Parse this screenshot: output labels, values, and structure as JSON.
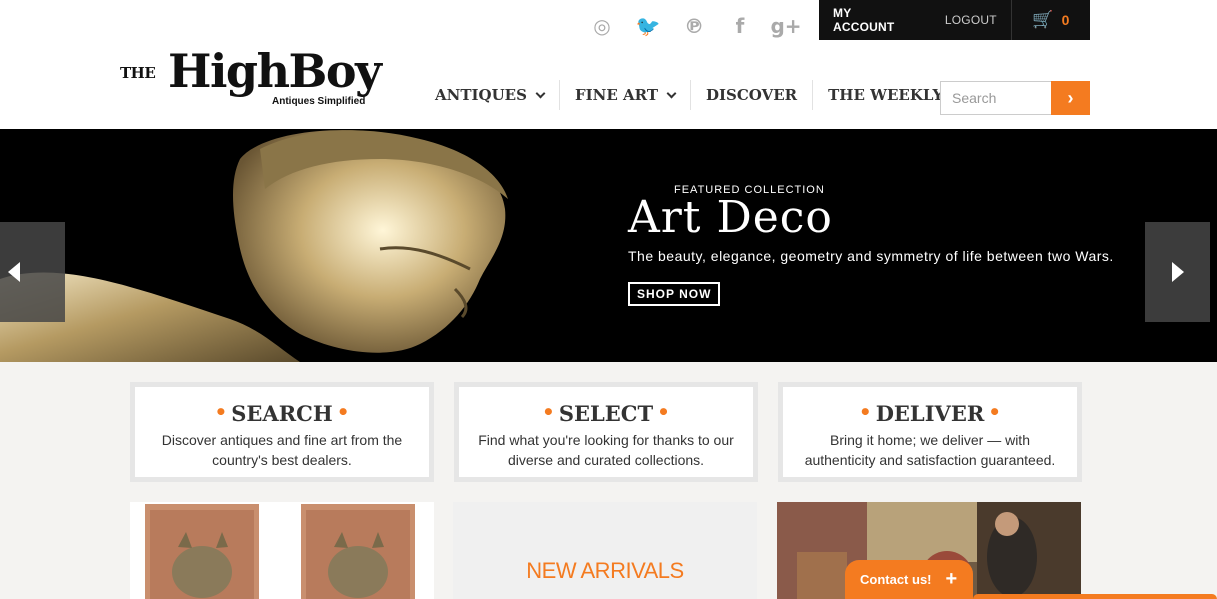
{
  "header": {
    "social": [
      {
        "name": "instagram-icon",
        "glyph": "◎"
      },
      {
        "name": "twitter-icon",
        "glyph": "🐦"
      },
      {
        "name": "pinterest-icon",
        "glyph": "℗"
      },
      {
        "name": "facebook-icon",
        "glyph": "f"
      },
      {
        "name": "google-plus-icon",
        "glyph": "g+"
      }
    ],
    "my_account": "MY ACCOUNT",
    "logout": "LOGOUT",
    "cart_icon": "🛒",
    "cart_count": "0",
    "logo": {
      "the": "THE",
      "name": "HighBoy",
      "tagline": "Antiques Simplified"
    },
    "nav": [
      {
        "label": "ANTIQUES",
        "has_dropdown": true
      },
      {
        "label": "FINE ART",
        "has_dropdown": true
      },
      {
        "label": "DISCOVER",
        "has_dropdown": false
      },
      {
        "label": "THE WEEKLY",
        "has_dropdown": false
      }
    ],
    "search": {
      "placeholder": "Search",
      "button_glyph": "›"
    }
  },
  "hero": {
    "kicker": "FEATURED COLLECTION",
    "title": "Art Deco",
    "description": "The beauty, elegance, geometry and symmetry of life between two Wars.",
    "cta": "SHOP NOW"
  },
  "steps": [
    {
      "title": "SEARCH",
      "text": "Discover antiques and fine art from the country's best dealers."
    },
    {
      "title": "SELECT",
      "text": "Find what you're looking for thanks to our diverse and curated collections."
    },
    {
      "title": "DELIVER",
      "text": "Bring it home; we deliver — with authenticity and satisfaction guaranteed."
    }
  ],
  "tiles": {
    "new_arrivals": "NEW ARRIVALS"
  },
  "contact": {
    "label": "Contact us!",
    "plus": "+"
  },
  "colors": {
    "accent": "#f47b20",
    "black_bar": "#111111"
  }
}
